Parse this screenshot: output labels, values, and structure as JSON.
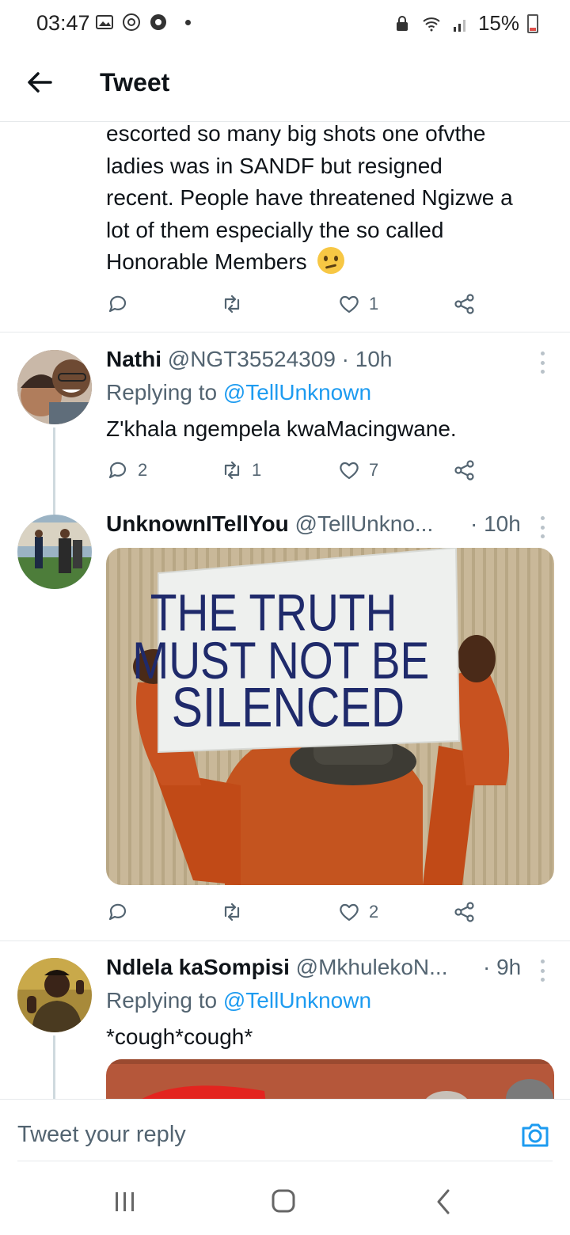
{
  "status_bar": {
    "time": "03:47",
    "battery": "15%"
  },
  "header": {
    "title": "Tweet"
  },
  "main_tweet_tail": {
    "lines": [
      "escorted so many big shots one ofvthe",
      "ladies was in SANDF but resigned",
      "recent. People have threatened Ngizwe a",
      "lot of them especially the so called",
      "Honorable Members"
    ],
    "emoji": "🙁",
    "likes": "1"
  },
  "replies": [
    {
      "name": "Nathi",
      "handle": "@NGT35524309",
      "time": "· 10h",
      "replying_prefix": "Replying to ",
      "replying_handle": "@TellUnknown",
      "text": "Z'khala ngempela kwaMacingwane.",
      "replies": "2",
      "retweets": "1",
      "likes": "7"
    },
    {
      "name": "UnknownITellYou",
      "handle": "@TellUnkno...",
      "time": "· 10h",
      "sign_lines": [
        "THE TRUTH",
        "MUST NOT BE",
        "SILENCED"
      ],
      "likes": "2"
    },
    {
      "name": "Ndlela kaSompisi",
      "handle": "@MkhulekoN...",
      "time": "· 9h",
      "replying_prefix": "Replying to ",
      "replying_handle": "@TellUnknown",
      "text": "*cough*cough*"
    }
  ],
  "reply_bar": {
    "placeholder": "Tweet your reply"
  },
  "colors": {
    "accent": "#1d9bf0",
    "secondary_text": "#536471",
    "divider": "#e6e9eb"
  }
}
